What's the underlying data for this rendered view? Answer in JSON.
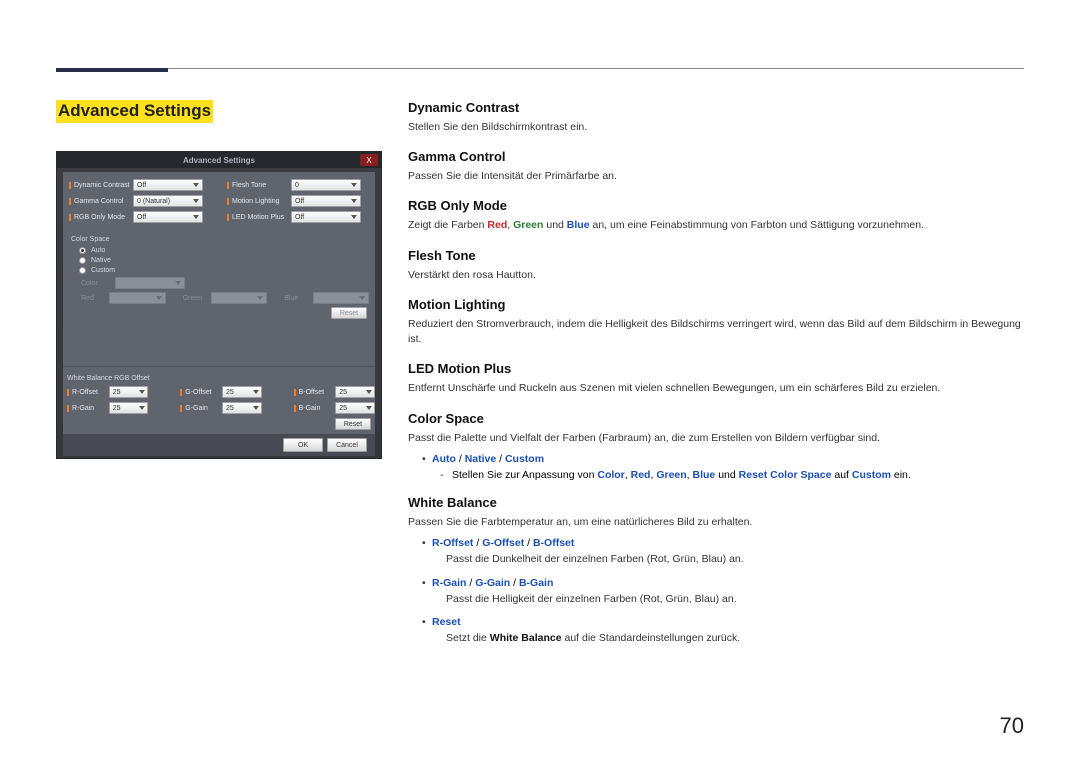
{
  "page_number": "70",
  "heading": "Advanced Settings",
  "dialog": {
    "title": "Advanced Settings",
    "close": "X",
    "row1": {
      "dyn_lbl": "Dynamic Contrast",
      "dyn_val": "Off",
      "ft_lbl": "Flesh Tone",
      "ft_val": "0"
    },
    "row2": {
      "gc_lbl": "Gamma Control",
      "gc_val": "0 (Natural)",
      "ml_lbl": "Motion Lighting",
      "ml_val": "Off"
    },
    "row3": {
      "rgb_lbl": "RGB Only Mode",
      "rgb_val": "Off",
      "lmp_lbl": "LED Motion Plus",
      "lmp_val": "Off"
    },
    "cs_title": "Color Space",
    "cs_auto": "Auto",
    "cs_native": "Native",
    "cs_custom": "Custom",
    "cs_color": "Color",
    "cs_red": "Red",
    "cs_green": "Green",
    "cs_blue": "Blue",
    "cs_reset": "Reset",
    "wb_title": "White Balance RGB Offset",
    "wb": {
      "r_off": "R-Offset",
      "r_off_v": "25",
      "g_off": "G-Offset",
      "g_off_v": "25",
      "b_off": "B-Offset",
      "b_off_v": "25",
      "r_gain": "R-Gain",
      "r_gain_v": "25",
      "g_gain": "G-Gain",
      "g_gain_v": "25",
      "b_gain": "B-Gain",
      "b_gain_v": "25"
    },
    "wb_reset": "Reset",
    "ok": "OK",
    "cancel": "Cancel"
  },
  "sections": {
    "dc_h": "Dynamic Contrast",
    "dc_b": "Stellen Sie den Bildschirmkontrast ein.",
    "gc_h": "Gamma Control",
    "gc_b": "Passen Sie die Intensität der Primärfarbe an.",
    "rgb_h": "RGB Only Mode",
    "rgb_pre": "Zeigt die Farben ",
    "rgb_red": "Red",
    "rgb_c1": ", ",
    "rgb_green": "Green",
    "rgb_c2": " und ",
    "rgb_blue": "Blue",
    "rgb_post": " an, um eine Feinabstimmung von Farbton und Sättigung vorzunehmen.",
    "ft_h": "Flesh Tone",
    "ft_b": "Verstärkt den rosa Hautton.",
    "ml_h": "Motion Lighting",
    "ml_b": "Reduziert den Stromverbrauch, indem die Helligkeit des Bildschirms verringert wird, wenn das Bild auf dem Bildschirm in Bewegung ist.",
    "lmp_h": "LED Motion Plus",
    "lmp_b": "Entfernt Unschärfe und Ruckeln aus Szenen mit vielen schnellen Bewegungen, um ein schärferes Bild zu erzielen.",
    "cs_h": "Color Space",
    "cs_b": "Passt die Palette und Vielfalt der Farben (Farbraum) an, die zum Erstellen von Bildern verfügbar sind.",
    "cs_opt_auto": "Auto",
    "cs_opt_sep": " / ",
    "cs_opt_native": "Native",
    "cs_opt_custom": "Custom",
    "cs_sub_pre": "Stellen Sie zur Anpassung von ",
    "cs_sub_color": "Color",
    "cs_sub_c": ", ",
    "cs_sub_red": "Red",
    "cs_sub_green": "Green",
    "cs_sub_blue": "Blue",
    "cs_sub_and": " und ",
    "cs_sub_reset": "Reset Color Space",
    "cs_sub_on": " auf ",
    "cs_sub_custom": "Custom",
    "cs_sub_post": " ein.",
    "wb_h": "White Balance",
    "wb_b": "Passen Sie die Farbtemperatur an, um eine natürlicheres Bild zu erhalten.",
    "wb_opt_roff": "R-Offset",
    "wb_opt_goff": "G-Offset",
    "wb_opt_boff": "B-Offset",
    "wb_opt_off_desc": "Passt die Dunkelheit der einzelnen Farben (Rot, Grün, Blau) an.",
    "wb_opt_rgain": "R-Gain",
    "wb_opt_ggain": "G-Gain",
    "wb_opt_bgain": "B-Gain",
    "wb_opt_gain_desc": "Passt die Helligkeit der einzelnen Farben (Rot, Grün, Blau) an.",
    "wb_opt_reset": "Reset",
    "wb_opt_reset_pre": "Setzt die ",
    "wb_opt_reset_wb": "White Balance",
    "wb_opt_reset_post": " auf die Standardeinstellungen zurück."
  }
}
